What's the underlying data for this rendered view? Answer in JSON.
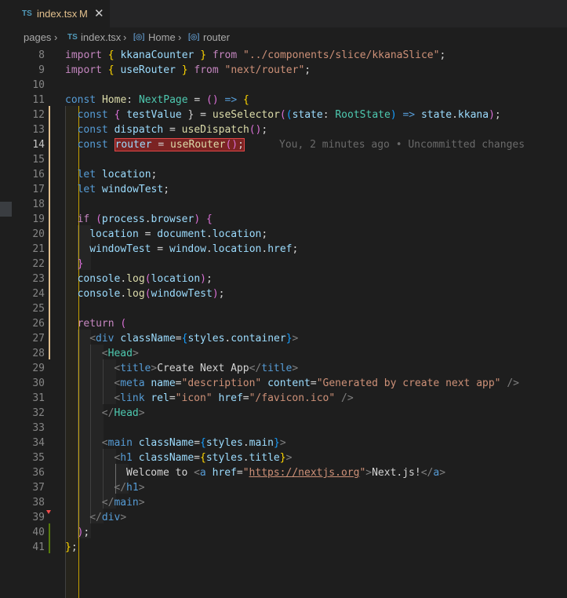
{
  "tab": {
    "lang_badge": "TS",
    "filename": "index.tsx",
    "modified": "M",
    "close": "✕"
  },
  "breadcrumb": {
    "root": "pages",
    "file_badge": "TS",
    "file": "index.tsx",
    "symbol1": "Home",
    "symbol2": "router"
  },
  "editor": {
    "current_line": 14,
    "blame": "You, 2 minutes ago • Uncommitted changes",
    "line_numbers": [
      "8",
      "9",
      "10",
      "11",
      "12",
      "13",
      "14",
      "15",
      "16",
      "17",
      "18",
      "19",
      "20",
      "21",
      "22",
      "23",
      "24",
      "25",
      "26",
      "27",
      "28",
      "29",
      "30",
      "31",
      "32",
      "33",
      "34",
      "35",
      "36",
      "37",
      "38",
      "39",
      "40",
      "41"
    ]
  },
  "code": {
    "l8": [
      "import ",
      "{ ",
      "kkanaCounter",
      " } ",
      "from ",
      "\"../components/slice/kkanaSlice\"",
      ";"
    ],
    "l9": [
      "import ",
      "{ ",
      "useRouter",
      " } ",
      "from ",
      "\"next/router\"",
      ";"
    ],
    "l11": [
      "const ",
      "Home",
      ": ",
      "NextPage",
      " = ",
      "()",
      " => ",
      "{"
    ],
    "l12": [
      "const ",
      "{ ",
      "testValue",
      " } = ",
      "useSelector",
      "(",
      "(",
      "state",
      ": ",
      "RootState",
      ")",
      " => ",
      "state",
      ".",
      "kkana",
      ")",
      ";"
    ],
    "l13": [
      "const ",
      "dispatch",
      " = ",
      "useDispatch",
      "()",
      ";"
    ],
    "l14": [
      "const ",
      "router",
      " = ",
      "useRouter",
      "()",
      ";"
    ],
    "l16": [
      "let ",
      "location",
      ";"
    ],
    "l17": [
      "let ",
      "windowTest",
      ";"
    ],
    "l19": [
      "if ",
      "(",
      "process",
      ".",
      "browser",
      ")",
      " {"
    ],
    "l20": [
      "location",
      " = ",
      "document",
      ".",
      "location",
      ";"
    ],
    "l21": [
      "windowTest",
      " = ",
      "window",
      ".",
      "location",
      ".",
      "href",
      ";"
    ],
    "l22": [
      "}"
    ],
    "l23": [
      "console",
      ".",
      "log",
      "(",
      "location",
      ")",
      ";"
    ],
    "l24": [
      "console",
      ".",
      "log",
      "(",
      "windowTest",
      ")",
      ";"
    ],
    "l26": [
      "return ",
      "("
    ],
    "l27": [
      "<",
      "div",
      " className",
      "=",
      "{",
      "styles",
      ".",
      "container",
      "}",
      ">"
    ],
    "l28": [
      "<",
      "Head",
      ">"
    ],
    "l29": [
      "<",
      "title",
      ">",
      "Create Next App",
      "</",
      "title",
      ">"
    ],
    "l30": [
      "<",
      "meta",
      " name",
      "=",
      "\"description\"",
      " content",
      "=",
      "\"Generated by create next app\"",
      " />"
    ],
    "l31": [
      "<",
      "link",
      " rel",
      "=",
      "\"icon\"",
      " href",
      "=",
      "\"/favicon.ico\"",
      " />"
    ],
    "l32": [
      "</",
      "Head",
      ">"
    ],
    "l34": [
      "<",
      "main",
      " className",
      "=",
      "{",
      "styles",
      ".",
      "main",
      "}",
      ">"
    ],
    "l35": [
      "<",
      "h1",
      " className",
      "=",
      "{",
      "styles",
      ".",
      "title",
      "}",
      ">"
    ],
    "l36": [
      "Welcome to ",
      "<",
      "a",
      " href",
      "=",
      "\"",
      "https://nextjs.org",
      "\"",
      ">",
      "Next.js!",
      "</",
      "a",
      ">"
    ],
    "l37": [
      "</",
      "h1",
      ">"
    ],
    "l38": [
      "</",
      "main",
      ">"
    ],
    "l39": [
      "</",
      "div",
      ">"
    ],
    "l40": [
      ")",
      ";"
    ],
    "l41": [
      "}",
      ";"
    ]
  }
}
